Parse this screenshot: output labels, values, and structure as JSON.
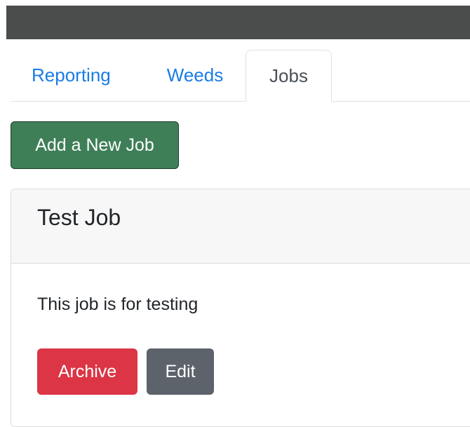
{
  "nav": {
    "tabs": [
      {
        "label": "Reporting",
        "active": false
      },
      {
        "label": "Weeds",
        "active": false
      },
      {
        "label": "Jobs",
        "active": true
      }
    ]
  },
  "actions": {
    "add_job_label": "Add a New Job"
  },
  "job_card": {
    "title": "Test Job",
    "description": "This job is for testing",
    "archive_label": "Archive",
    "edit_label": "Edit"
  },
  "colors": {
    "topbar": "#4a4d4c",
    "link": "#1a7ce6",
    "add_button": "#3e7f58",
    "archive_button": "#dc3545",
    "edit_button": "#5c636a",
    "card_header": "#f7f7f7"
  }
}
